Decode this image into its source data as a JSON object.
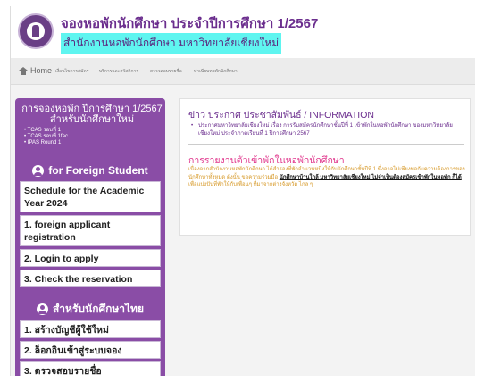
{
  "header": {
    "title": "จองหอพักนักศึกษา ประจำปีการศึกษา 1/2567",
    "subtitle": "สำนักงานหอพักนักศึกษา มหาวิทยาลัยเชียงใหม่"
  },
  "nav": {
    "home": "Home",
    "items": [
      "เงื่อนไขการสมัคร",
      "บริการและสวัสดิการ",
      "ตรวจสอบรายชื่อ",
      "ทำเนียบหอพักนักศึกษา"
    ]
  },
  "sidebar": {
    "heading_line1": "การจองหอพัก ปีการศึกษา 1/2567",
    "heading_line2": "สำหรับนักศึกษาใหม่",
    "rounds": [
      "TCAS รอบที่ 1",
      "TCAS รอบที่ 1fac",
      "IPAS Round 1"
    ],
    "foreign_section": "for Foreign Student",
    "foreign_items": [
      "Schedule for the Academic Year 2024",
      "1. foreign applicant registration",
      "2. Login to apply",
      "3. Check the reservation"
    ],
    "thai_section": "สำหรับนักศึกษาไทย",
    "thai_items": [
      "1. สร้างบัญชีผู้ใช้ใหม่",
      "2. ล็อกอินเข้าสู่ระบบจอง",
      "3. ตรวจสอบรายชื่อ"
    ]
  },
  "main": {
    "news_title": "ข่าว ประกาศ ประชาสัมพันธ์ / INFORMATION",
    "news_item": "ประกาศมหาวิทยาลัยเชียงใหม่ เรื่อง การรับสมัครนักศึกษาชั้นปีที่ 1 เข้าพักในหอพักนักศึกษา ของมหาวิทยาลัยเชียงใหม่ ประจำภาคเรียนที่ 1 ปีการศึกษา 2567",
    "report_title": "การรายงานตัวเข้าพักในหอพักนักศึกษา",
    "report_text_1": "เนื่องจากสำนักงานหอพักนักศึกษา ได้สำรองที่พักจำนวนหนึ่งให้กับนักศึกษาชั้นปีที่ 1 ซึ่งอาจไม่เพียงพอกับความต้องการของนักศึกษาทั้งหมด ดังนั้น ขอความร่วมมือ ",
    "report_link": "นักศึกษาบ้านใกล้ มหาวิทยาลัยเชียงใหม่ ไม่จำเป็นต้องสมัครเข้าพักในหอพัก ก็ได้",
    "report_text_2": " เพื่อแบ่งปันที่พักให้กับเพื่อนๆ ที่มาจากต่างจังหวัด ไกล ๆ"
  },
  "colors": {
    "accent_purple": "#8a4da6",
    "title_purple": "#6b2e8e",
    "subtitle_highlight": "#5ff5f0",
    "report_pink": "#e0348b",
    "report_orange": "#d79a2a"
  }
}
